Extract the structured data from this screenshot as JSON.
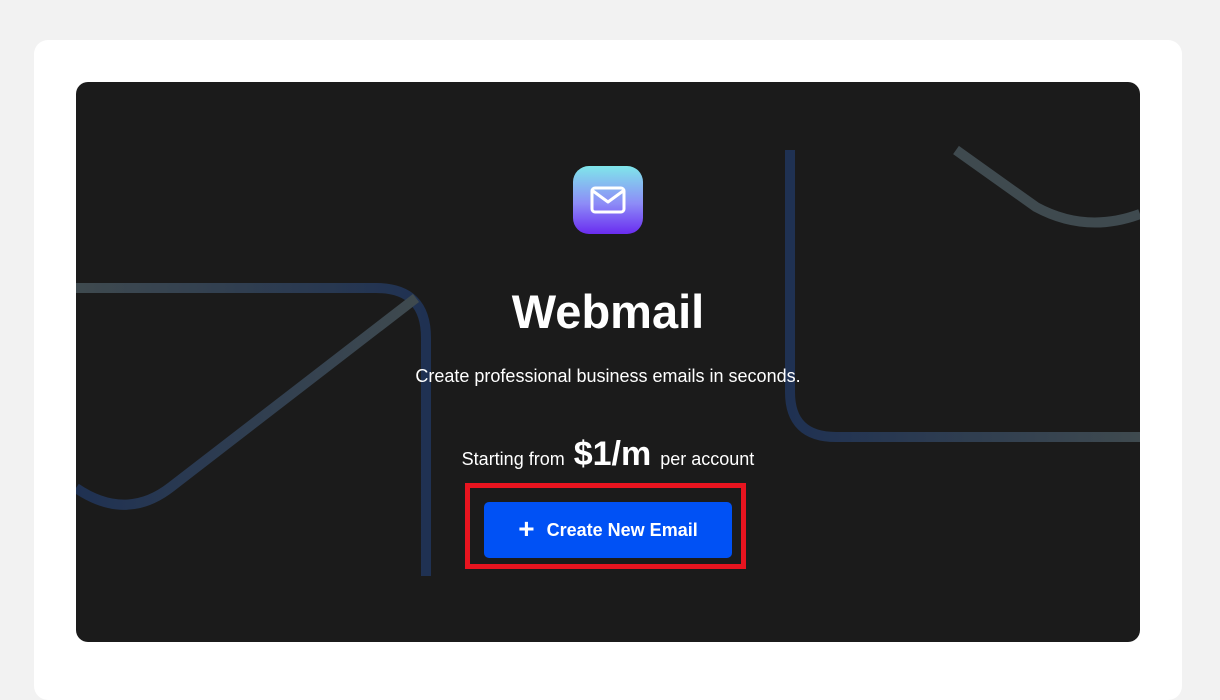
{
  "hero": {
    "icon": "mail-envelope-icon",
    "title": "Webmail",
    "subtitle": "Create professional business emails in seconds.",
    "pricing": {
      "prefix": "Starting from",
      "price": "$1/m",
      "suffix": "per account"
    },
    "cta": {
      "icon": "plus-icon",
      "plus_glyph": "+",
      "label": "Create New Email"
    }
  },
  "colors": {
    "page_background": "#f2f2f2",
    "card_background": "#ffffff",
    "hero_background": "#1b1b1b",
    "button_background": "#0051f5",
    "highlight_border": "#e8141f",
    "icon_gradient_top": "#7fe6ea",
    "icon_gradient_bottom": "#6a2cf0"
  }
}
